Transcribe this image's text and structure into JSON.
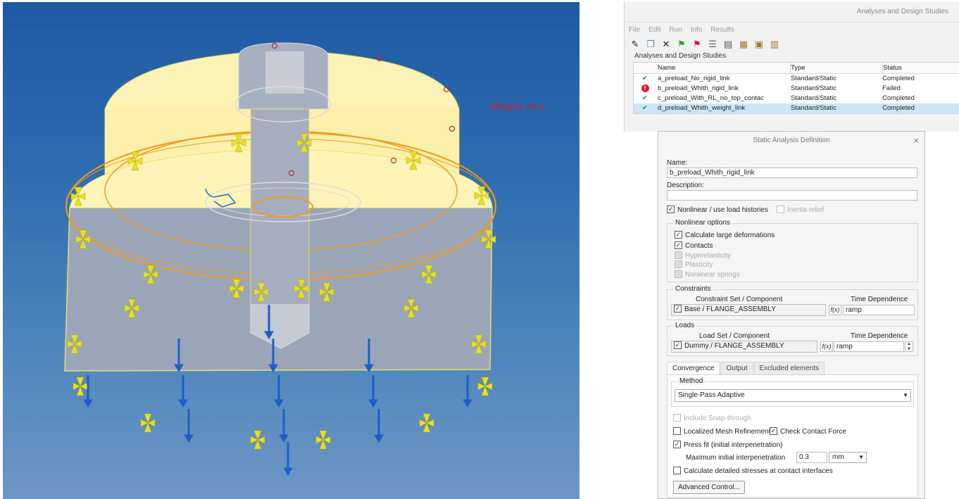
{
  "viewport": {
    "annotation": "dRigid1 mk1"
  },
  "analyses_window": {
    "title": "Analyses and Design Studies",
    "menu": [
      "File",
      "Edit",
      "Run",
      "Info",
      "Results"
    ],
    "section_label": "Analyses and Design Studies",
    "columns": [
      "Name",
      "Type",
      "Status"
    ],
    "rows": [
      {
        "name": "a_preload_No_rigid_link",
        "type": "Standard/Static",
        "status": "Completed",
        "icon": "check-icon"
      },
      {
        "name": "b_preload_Whith_rigid_link",
        "type": "Standard/Static",
        "status": "Failed",
        "icon": "error-icon"
      },
      {
        "name": "c_preload_With_RL_no_top_contac",
        "type": "Standard/Static",
        "status": "Completed",
        "icon": "check-icon"
      },
      {
        "name": "d_preload_Whith_weight_link",
        "type": "Standard/Static",
        "status": "Completed",
        "icon": "check-icon",
        "selected": true
      }
    ]
  },
  "dialog": {
    "title": "Static Analysis Definition",
    "close": "×",
    "name_label": "Name:",
    "name_value": "b_preload_Whith_rigid_link",
    "description_label": "Description:",
    "description_value": "",
    "nonlinear_label": "Nonlinear / use load histories",
    "inertia_label": "Inertia relief",
    "nonlinear_options": {
      "title": "Nonlinear options",
      "large_def": "Calculate large deformations",
      "contacts": "Contacts",
      "hyper": "Hyperelasticity",
      "plasticity": "Plasticity",
      "springs": "Nonlinear springs"
    },
    "constraints": {
      "title": "Constraints",
      "col1": "Constraint Set / Component",
      "col2": "Time Dependence",
      "value": "Base / FLANGE_ASSEMBLY",
      "fx": "f(x)",
      "time": "ramp"
    },
    "loads": {
      "title": "Loads",
      "col1": "Load Set / Component",
      "col2": "Time Dependence",
      "value": "Dummy / FLANGE_ASSEMBLY",
      "fx": "f(x)",
      "time": "ramp"
    },
    "tabs": [
      "Convergence",
      "Output",
      "Excluded elements"
    ],
    "method_label": "Method",
    "method_value": "Single-Pass Adaptive",
    "snap": "Include Snap-through",
    "mesh_ref": "Localized Mesh Refinement",
    "check_contact": "Check Contact Force",
    "press_fit": "Press fit (initial interpenetration)",
    "max_interp_label": "Maximum initial interpenetration",
    "max_interp_value": "0.3",
    "unit": "mm",
    "detailed": "Calculate detailed stresses at contact interfaces",
    "advanced": "Advanced Control..."
  }
}
